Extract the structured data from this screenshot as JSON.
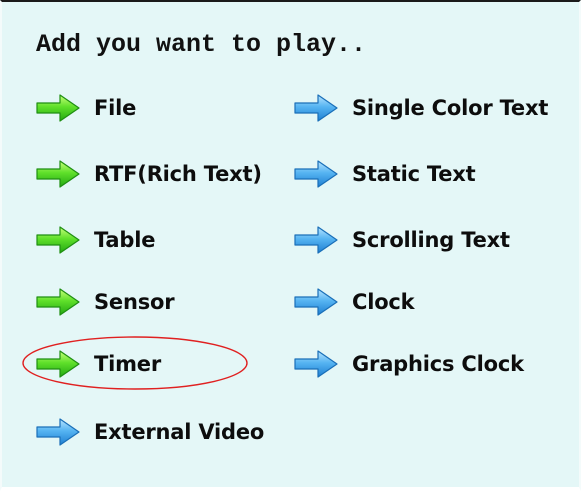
{
  "panel": {
    "heading": "Add you want to play.."
  },
  "colors": {
    "background": "#e4f7f7",
    "green_arrow": "#3fcf1f",
    "blue_arrow": "#3aa0e8",
    "annotation_circle": "#e02020"
  },
  "left_column": [
    {
      "label": "File",
      "icon": "green-arrow-icon"
    },
    {
      "label": "RTF(Rich Text)",
      "icon": "green-arrow-icon"
    },
    {
      "label": "Table",
      "icon": "green-arrow-icon"
    },
    {
      "label": "Sensor",
      "icon": "green-arrow-icon"
    },
    {
      "label": "Timer",
      "icon": "green-arrow-icon"
    },
    {
      "label": "External Video",
      "icon": "blue-arrow-icon"
    }
  ],
  "right_column": [
    {
      "label": "Single Color Text",
      "icon": "blue-arrow-icon"
    },
    {
      "label": "Static Text",
      "icon": "blue-arrow-icon"
    },
    {
      "label": "Scrolling Text",
      "icon": "blue-arrow-icon"
    },
    {
      "label": "Clock",
      "icon": "blue-arrow-icon"
    },
    {
      "label": "Graphics Clock",
      "icon": "blue-arrow-icon"
    }
  ],
  "annotation": {
    "shape": "ellipse",
    "highlighted_item": "Timer"
  }
}
